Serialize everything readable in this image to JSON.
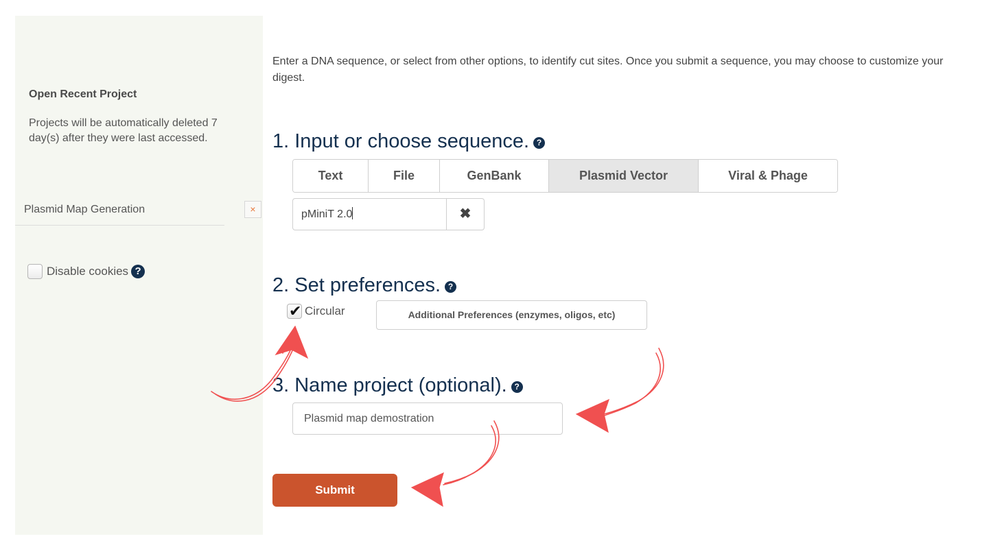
{
  "sidebar": {
    "title": "Open Recent Project",
    "description": "Projects will be automatically deleted 7 day(s) after they were last accessed.",
    "projects": [
      {
        "name": "Plasmid Map Generation",
        "remove_icon": "close-icon",
        "remove_glyph": "×"
      }
    ],
    "disable_cookies_label": "Disable cookies",
    "disable_cookies_checked": false,
    "help_glyph": "?"
  },
  "main": {
    "intro": "Enter a DNA sequence, or select from other options, to identify cut sites. Once you submit a sequence, you may choose to customize your digest.",
    "step1": {
      "heading": "1. Input or choose sequence.",
      "tabs": [
        {
          "label": "Text",
          "active": false
        },
        {
          "label": "File",
          "active": false
        },
        {
          "label": "GenBank",
          "active": false
        },
        {
          "label": "Plasmid Vector",
          "active": true
        },
        {
          "label": "Viral & Phage",
          "active": false
        }
      ],
      "sequence_value": "pMiniT 2.0",
      "clear_glyph": "✖"
    },
    "step2": {
      "heading": "2. Set preferences.",
      "circular_label": "Circular",
      "circular_checked": true,
      "additional_button": "Additional Preferences (enzymes, oligos, etc)"
    },
    "step3": {
      "heading": "3. Name project (optional).",
      "project_name_value": "Plasmid map demostration"
    },
    "submit_label": "Submit",
    "help_glyph": "?"
  },
  "colors": {
    "sidebar_bg": "#f5f7f1",
    "heading": "#14304f",
    "submit": "#cb542d",
    "annotation": "#f05050",
    "remove_x": "#e8773a"
  },
  "annotations": [
    {
      "type": "hand-drawn-arrow",
      "points_to": "circular-checkbox"
    },
    {
      "type": "hand-drawn-arrow",
      "points_to": "project-name-input"
    },
    {
      "type": "hand-drawn-arrow",
      "points_to": "submit-button"
    }
  ]
}
